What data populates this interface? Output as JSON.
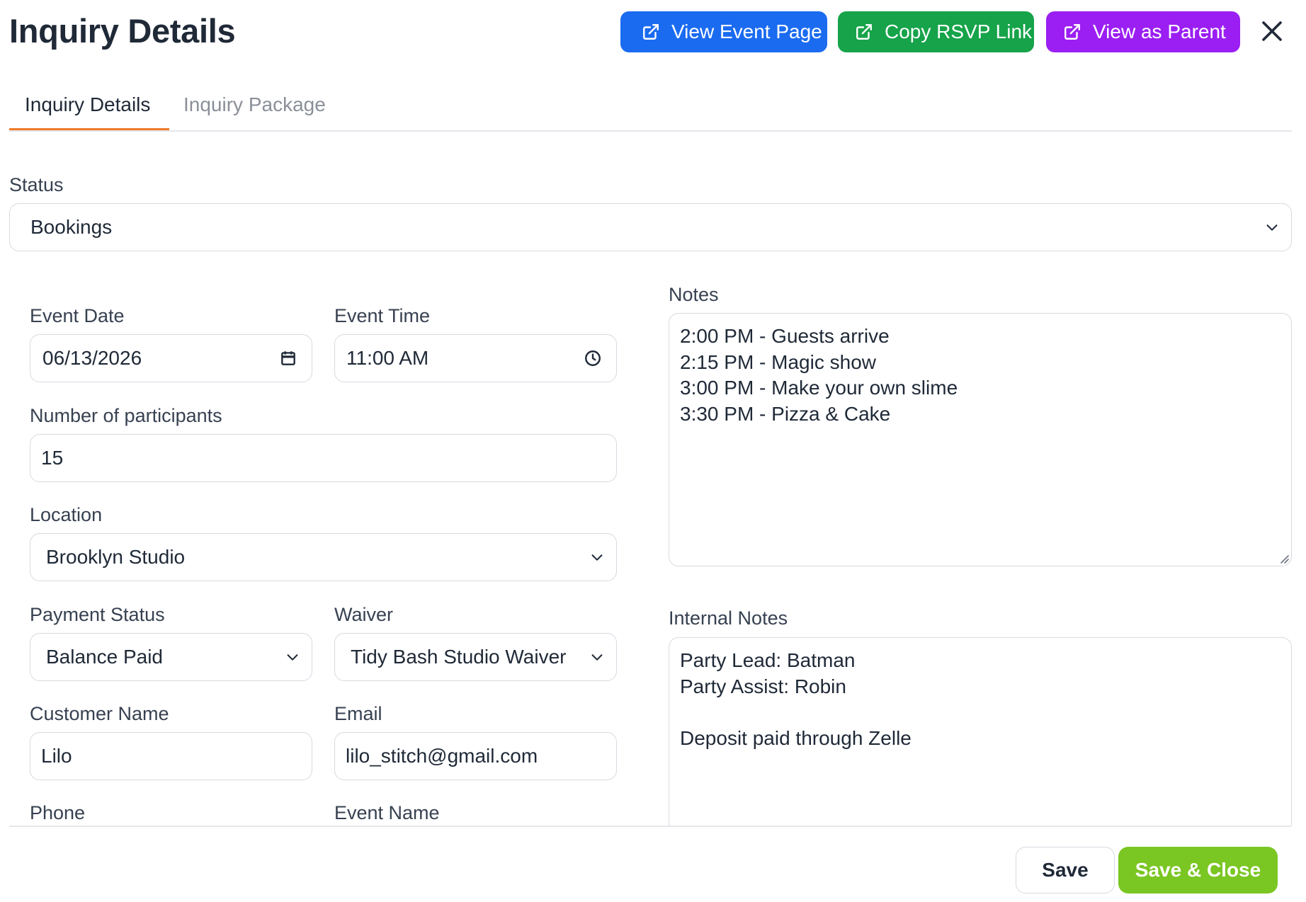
{
  "modal": {
    "title": "Inquiry Details"
  },
  "header_buttons": [
    {
      "label": "View Event Page",
      "color": "#1a6bf0"
    },
    {
      "label": "Copy RSVP Link",
      "color": "#16a34a"
    },
    {
      "label": "View as Parent",
      "color": "#9b1ff2"
    }
  ],
  "tabs": [
    {
      "label": "Inquiry Details",
      "active": true
    },
    {
      "label": "Inquiry Package",
      "active": false
    }
  ],
  "accent_color": "#f07a2a",
  "form": {
    "status": {
      "label": "Status",
      "value": "Bookings"
    },
    "event_date": {
      "label": "Event Date",
      "value": "06/13/2026"
    },
    "event_time": {
      "label": "Event Time",
      "value": "11:00  AM"
    },
    "participants": {
      "label": "Number of participants",
      "value": "15"
    },
    "location": {
      "label": "Location",
      "value": "Brooklyn Studio"
    },
    "payment_status": {
      "label": "Payment Status",
      "value": "Balance Paid"
    },
    "waiver": {
      "label": "Waiver",
      "value": "Tidy Bash Studio Waiver"
    },
    "customer_name": {
      "label": "Customer Name",
      "value": "Lilo"
    },
    "email": {
      "label": "Email",
      "value": "lilo_stitch@gmail.com"
    },
    "phone": {
      "label": "Phone"
    },
    "event_name": {
      "label": "Event Name"
    },
    "notes": {
      "label": "Notes",
      "lines": [
        "2:00 PM - Guests arrive",
        "2:15 PM - Magic show",
        "3:00 PM - Make your own slime",
        "3:30 PM - Pizza & Cake"
      ]
    },
    "internal_notes": {
      "label": "Internal Notes",
      "lines": [
        "Party Lead: Batman",
        "Party Assist: Robin",
        "",
        "Deposit paid through Zelle"
      ]
    }
  },
  "footer": {
    "save_label": "Save",
    "save_close_label": "Save & Close",
    "save_close_color": "#7ac623"
  }
}
